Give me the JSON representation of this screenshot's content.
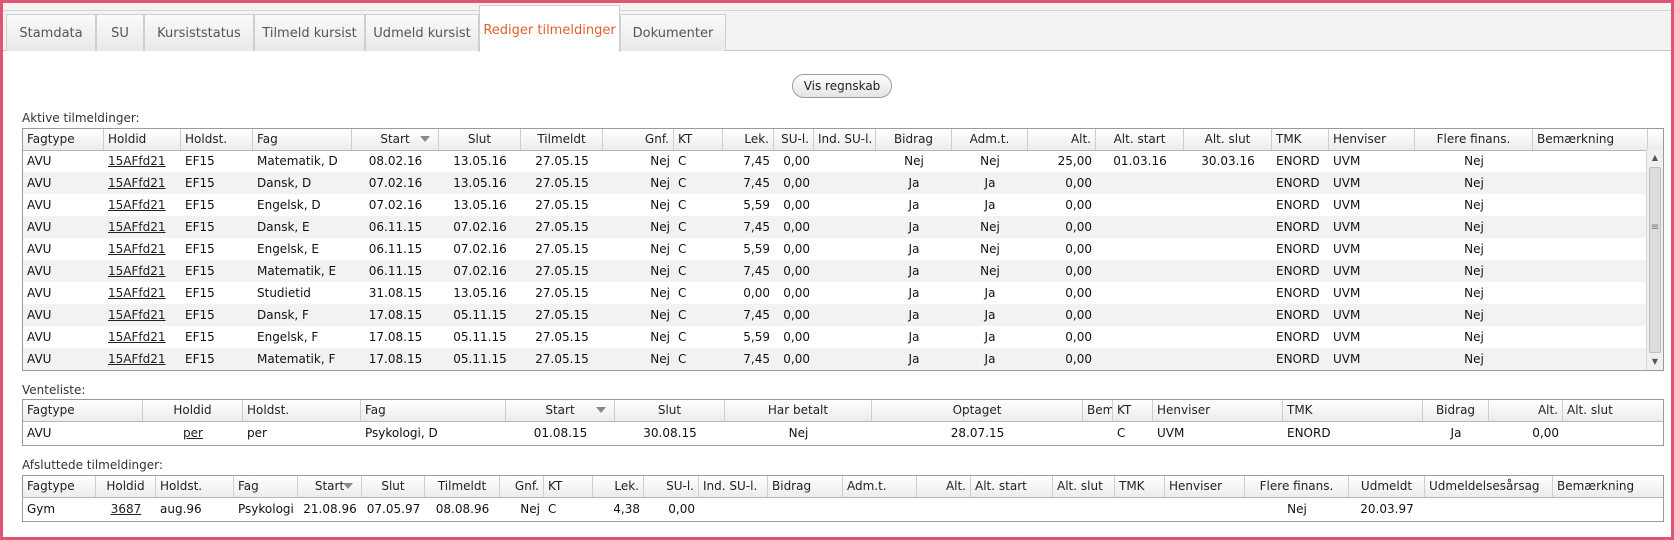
{
  "tabs": [
    {
      "label": "Stamdata",
      "active": false
    },
    {
      "label": "SU",
      "active": false
    },
    {
      "label": "Kursiststatus",
      "active": false
    },
    {
      "label": "Tilmeld kursist",
      "active": false
    },
    {
      "label": "Udmeld kursist",
      "active": false
    },
    {
      "label": "Rediger tilmeldinger",
      "active": true
    },
    {
      "label": "Dokumenter",
      "active": false
    }
  ],
  "vis_regnskab_label": "Vis regnskab",
  "active": {
    "label": "Aktive tilmeldinger:",
    "columns": [
      "Fagtype",
      "Holdid",
      "Holdst.",
      "Fag",
      "Start",
      "Slut",
      "Tilmeldt",
      "Gnf.",
      "KT",
      "Lek.",
      "SU-l.",
      "Ind. SU-l.",
      "Bidrag",
      "Adm.t.",
      "Alt.",
      "Alt. start",
      "Alt. slut",
      "TMK",
      "Henviser",
      "Flere finans.",
      "Bemærkning"
    ],
    "rows": [
      [
        "AVU",
        "15AFfd21",
        "EF15",
        "Matematik, D",
        "08.02.16",
        "13.05.16",
        "27.05.15",
        "Nej",
        "C",
        "7,45",
        "0,00",
        "",
        "Nej",
        "Nej",
        "25,00",
        "01.03.16",
        "30.03.16",
        "ENORD",
        "UVM",
        "Nej",
        ""
      ],
      [
        "AVU",
        "15AFfd21",
        "EF15",
        "Dansk, D",
        "07.02.16",
        "13.05.16",
        "27.05.15",
        "Nej",
        "C",
        "7,45",
        "0,00",
        "",
        "Ja",
        "Ja",
        "0,00",
        "",
        "",
        "ENORD",
        "UVM",
        "Nej",
        ""
      ],
      [
        "AVU",
        "15AFfd21",
        "EF15",
        "Engelsk, D",
        "07.02.16",
        "13.05.16",
        "27.05.15",
        "Nej",
        "C",
        "5,59",
        "0,00",
        "",
        "Ja",
        "Ja",
        "0,00",
        "",
        "",
        "ENORD",
        "UVM",
        "Nej",
        ""
      ],
      [
        "AVU",
        "15AFfd21",
        "EF15",
        "Dansk, E",
        "06.11.15",
        "07.02.16",
        "27.05.15",
        "Nej",
        "C",
        "7,45",
        "0,00",
        "",
        "Ja",
        "Nej",
        "0,00",
        "",
        "",
        "ENORD",
        "UVM",
        "Nej",
        ""
      ],
      [
        "AVU",
        "15AFfd21",
        "EF15",
        "Engelsk, E",
        "06.11.15",
        "07.02.16",
        "27.05.15",
        "Nej",
        "C",
        "5,59",
        "0,00",
        "",
        "Ja",
        "Nej",
        "0,00",
        "",
        "",
        "ENORD",
        "UVM",
        "Nej",
        ""
      ],
      [
        "AVU",
        "15AFfd21",
        "EF15",
        "Matematik, E",
        "06.11.15",
        "07.02.16",
        "27.05.15",
        "Nej",
        "C",
        "7,45",
        "0,00",
        "",
        "Ja",
        "Nej",
        "0,00",
        "",
        "",
        "ENORD",
        "UVM",
        "Nej",
        ""
      ],
      [
        "AVU",
        "15AFfd21",
        "EF15",
        "Studietid",
        "31.08.15",
        "13.05.16",
        "27.05.15",
        "Nej",
        "C",
        "0,00",
        "0,00",
        "",
        "Ja",
        "Ja",
        "0,00",
        "",
        "",
        "ENORD",
        "UVM",
        "Nej",
        ""
      ],
      [
        "AVU",
        "15AFfd21",
        "EF15",
        "Dansk, F",
        "17.08.15",
        "05.11.15",
        "27.05.15",
        "Nej",
        "C",
        "7,45",
        "0,00",
        "",
        "Ja",
        "Ja",
        "0,00",
        "",
        "",
        "ENORD",
        "UVM",
        "Nej",
        ""
      ],
      [
        "AVU",
        "15AFfd21",
        "EF15",
        "Engelsk, F",
        "17.08.15",
        "05.11.15",
        "27.05.15",
        "Nej",
        "C",
        "5,59",
        "0,00",
        "",
        "Ja",
        "Ja",
        "0,00",
        "",
        "",
        "ENORD",
        "UVM",
        "Nej",
        ""
      ],
      [
        "AVU",
        "15AFfd21",
        "EF15",
        "Matematik, F",
        "17.08.15",
        "05.11.15",
        "27.05.15",
        "Nej",
        "C",
        "7,45",
        "0,00",
        "",
        "Ja",
        "Ja",
        "0,00",
        "",
        "",
        "ENORD",
        "UVM",
        "Nej",
        ""
      ]
    ]
  },
  "waitlist": {
    "label": "Venteliste:",
    "columns": [
      "Fagtype",
      "Holdid",
      "Holdst.",
      "Fag",
      "Start",
      "Slut",
      "Har betalt",
      "Optaget",
      "Bem.",
      "KT",
      "Henviser",
      "TMK",
      "Bidrag",
      "Alt.",
      "Alt. slut"
    ],
    "rows": [
      [
        "AVU",
        "per",
        "per",
        "Psykologi, D",
        "01.08.15",
        "30.08.15",
        "Nej",
        "28.07.15",
        "",
        "C",
        "UVM",
        "ENORD",
        "Ja",
        "0,00",
        ""
      ]
    ]
  },
  "finished": {
    "label": "Afsluttede tilmeldinger:",
    "columns": [
      "Fagtype",
      "Holdid",
      "Holdst.",
      "Fag",
      "Start",
      "Slut",
      "Tilmeldt",
      "Gnf.",
      "KT",
      "Lek.",
      "SU-l.",
      "Ind. SU-l.",
      "Bidrag",
      "Adm.t.",
      "Alt.",
      "Alt. start",
      "Alt. slut",
      "TMK",
      "Henviser",
      "Flere finans.",
      "Udmeldt",
      "Udmeldelsesårsag",
      "Bemærkning"
    ],
    "rows": [
      [
        "Gym",
        "3687",
        "aug.96",
        "Psykologi",
        "21.08.96",
        "07.05.97",
        "08.08.96",
        "Nej",
        "C",
        "4,38",
        "0,00",
        "",
        "",
        "",
        "",
        "",
        "",
        "",
        "",
        "Nej",
        "20.03.97",
        "",
        ""
      ]
    ]
  }
}
